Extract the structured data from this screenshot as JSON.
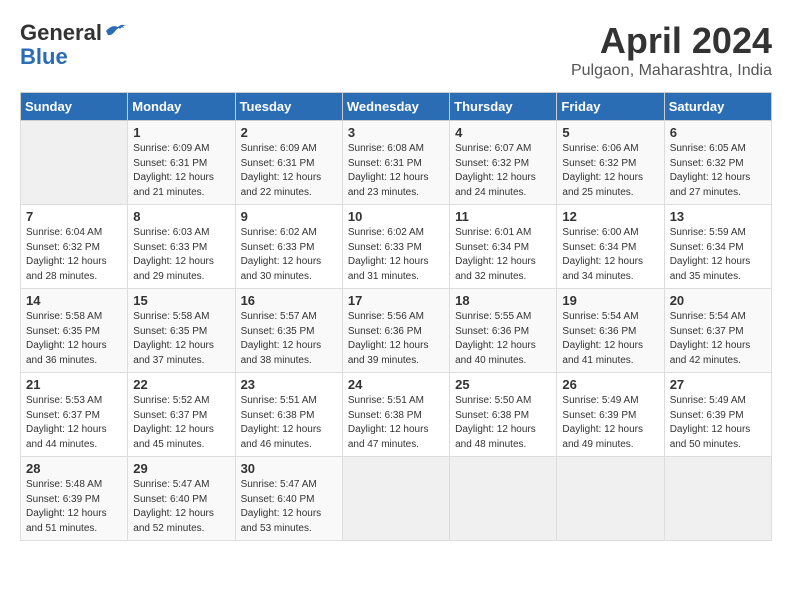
{
  "logo": {
    "general": "General",
    "blue": "Blue"
  },
  "title": "April 2024",
  "location": "Pulgaon, Maharashtra, India",
  "days_of_week": [
    "Sunday",
    "Monday",
    "Tuesday",
    "Wednesday",
    "Thursday",
    "Friday",
    "Saturday"
  ],
  "weeks": [
    [
      {
        "day": "",
        "sunrise": "",
        "sunset": "",
        "daylight": ""
      },
      {
        "day": "1",
        "sunrise": "Sunrise: 6:09 AM",
        "sunset": "Sunset: 6:31 PM",
        "daylight": "Daylight: 12 hours and 21 minutes."
      },
      {
        "day": "2",
        "sunrise": "Sunrise: 6:09 AM",
        "sunset": "Sunset: 6:31 PM",
        "daylight": "Daylight: 12 hours and 22 minutes."
      },
      {
        "day": "3",
        "sunrise": "Sunrise: 6:08 AM",
        "sunset": "Sunset: 6:31 PM",
        "daylight": "Daylight: 12 hours and 23 minutes."
      },
      {
        "day": "4",
        "sunrise": "Sunrise: 6:07 AM",
        "sunset": "Sunset: 6:32 PM",
        "daylight": "Daylight: 12 hours and 24 minutes."
      },
      {
        "day": "5",
        "sunrise": "Sunrise: 6:06 AM",
        "sunset": "Sunset: 6:32 PM",
        "daylight": "Daylight: 12 hours and 25 minutes."
      },
      {
        "day": "6",
        "sunrise": "Sunrise: 6:05 AM",
        "sunset": "Sunset: 6:32 PM",
        "daylight": "Daylight: 12 hours and 27 minutes."
      }
    ],
    [
      {
        "day": "7",
        "sunrise": "Sunrise: 6:04 AM",
        "sunset": "Sunset: 6:32 PM",
        "daylight": "Daylight: 12 hours and 28 minutes."
      },
      {
        "day": "8",
        "sunrise": "Sunrise: 6:03 AM",
        "sunset": "Sunset: 6:33 PM",
        "daylight": "Daylight: 12 hours and 29 minutes."
      },
      {
        "day": "9",
        "sunrise": "Sunrise: 6:02 AM",
        "sunset": "Sunset: 6:33 PM",
        "daylight": "Daylight: 12 hours and 30 minutes."
      },
      {
        "day": "10",
        "sunrise": "Sunrise: 6:02 AM",
        "sunset": "Sunset: 6:33 PM",
        "daylight": "Daylight: 12 hours and 31 minutes."
      },
      {
        "day": "11",
        "sunrise": "Sunrise: 6:01 AM",
        "sunset": "Sunset: 6:34 PM",
        "daylight": "Daylight: 12 hours and 32 minutes."
      },
      {
        "day": "12",
        "sunrise": "Sunrise: 6:00 AM",
        "sunset": "Sunset: 6:34 PM",
        "daylight": "Daylight: 12 hours and 34 minutes."
      },
      {
        "day": "13",
        "sunrise": "Sunrise: 5:59 AM",
        "sunset": "Sunset: 6:34 PM",
        "daylight": "Daylight: 12 hours and 35 minutes."
      }
    ],
    [
      {
        "day": "14",
        "sunrise": "Sunrise: 5:58 AM",
        "sunset": "Sunset: 6:35 PM",
        "daylight": "Daylight: 12 hours and 36 minutes."
      },
      {
        "day": "15",
        "sunrise": "Sunrise: 5:58 AM",
        "sunset": "Sunset: 6:35 PM",
        "daylight": "Daylight: 12 hours and 37 minutes."
      },
      {
        "day": "16",
        "sunrise": "Sunrise: 5:57 AM",
        "sunset": "Sunset: 6:35 PM",
        "daylight": "Daylight: 12 hours and 38 minutes."
      },
      {
        "day": "17",
        "sunrise": "Sunrise: 5:56 AM",
        "sunset": "Sunset: 6:36 PM",
        "daylight": "Daylight: 12 hours and 39 minutes."
      },
      {
        "day": "18",
        "sunrise": "Sunrise: 5:55 AM",
        "sunset": "Sunset: 6:36 PM",
        "daylight": "Daylight: 12 hours and 40 minutes."
      },
      {
        "day": "19",
        "sunrise": "Sunrise: 5:54 AM",
        "sunset": "Sunset: 6:36 PM",
        "daylight": "Daylight: 12 hours and 41 minutes."
      },
      {
        "day": "20",
        "sunrise": "Sunrise: 5:54 AM",
        "sunset": "Sunset: 6:37 PM",
        "daylight": "Daylight: 12 hours and 42 minutes."
      }
    ],
    [
      {
        "day": "21",
        "sunrise": "Sunrise: 5:53 AM",
        "sunset": "Sunset: 6:37 PM",
        "daylight": "Daylight: 12 hours and 44 minutes."
      },
      {
        "day": "22",
        "sunrise": "Sunrise: 5:52 AM",
        "sunset": "Sunset: 6:37 PM",
        "daylight": "Daylight: 12 hours and 45 minutes."
      },
      {
        "day": "23",
        "sunrise": "Sunrise: 5:51 AM",
        "sunset": "Sunset: 6:38 PM",
        "daylight": "Daylight: 12 hours and 46 minutes."
      },
      {
        "day": "24",
        "sunrise": "Sunrise: 5:51 AM",
        "sunset": "Sunset: 6:38 PM",
        "daylight": "Daylight: 12 hours and 47 minutes."
      },
      {
        "day": "25",
        "sunrise": "Sunrise: 5:50 AM",
        "sunset": "Sunset: 6:38 PM",
        "daylight": "Daylight: 12 hours and 48 minutes."
      },
      {
        "day": "26",
        "sunrise": "Sunrise: 5:49 AM",
        "sunset": "Sunset: 6:39 PM",
        "daylight": "Daylight: 12 hours and 49 minutes."
      },
      {
        "day": "27",
        "sunrise": "Sunrise: 5:49 AM",
        "sunset": "Sunset: 6:39 PM",
        "daylight": "Daylight: 12 hours and 50 minutes."
      }
    ],
    [
      {
        "day": "28",
        "sunrise": "Sunrise: 5:48 AM",
        "sunset": "Sunset: 6:39 PM",
        "daylight": "Daylight: 12 hours and 51 minutes."
      },
      {
        "day": "29",
        "sunrise": "Sunrise: 5:47 AM",
        "sunset": "Sunset: 6:40 PM",
        "daylight": "Daylight: 12 hours and 52 minutes."
      },
      {
        "day": "30",
        "sunrise": "Sunrise: 5:47 AM",
        "sunset": "Sunset: 6:40 PM",
        "daylight": "Daylight: 12 hours and 53 minutes."
      },
      {
        "day": "",
        "sunrise": "",
        "sunset": "",
        "daylight": ""
      },
      {
        "day": "",
        "sunrise": "",
        "sunset": "",
        "daylight": ""
      },
      {
        "day": "",
        "sunrise": "",
        "sunset": "",
        "daylight": ""
      },
      {
        "day": "",
        "sunrise": "",
        "sunset": "",
        "daylight": ""
      }
    ]
  ]
}
